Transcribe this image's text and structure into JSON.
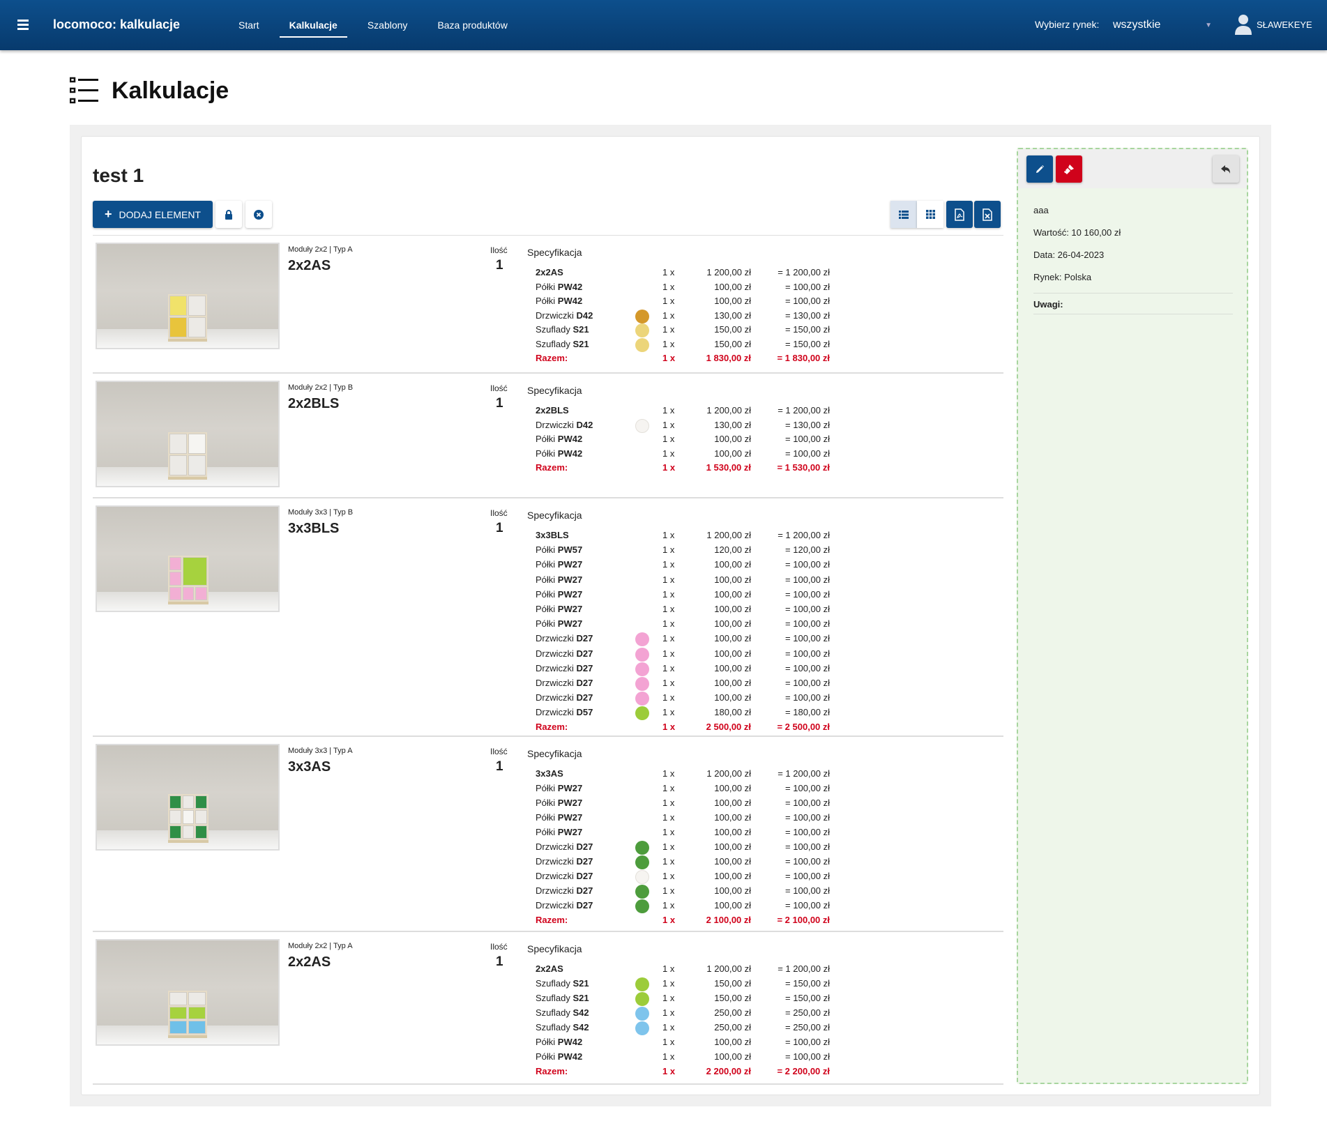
{
  "app": {
    "title": "locomoco: kalkulacje"
  },
  "nav": [
    {
      "label": "Start",
      "active": false
    },
    {
      "label": "Kalkulacje",
      "active": true
    },
    {
      "label": "Szablony",
      "active": false
    },
    {
      "label": "Baza produktów",
      "active": false
    }
  ],
  "market": {
    "label": "Wybierz rynek:",
    "value": "wszystkie"
  },
  "user": {
    "name": "SŁAWEKEYE"
  },
  "page": {
    "title": "Kalkulacje"
  },
  "calc": {
    "title": "test 1",
    "add_label": "DODAJ ELEMENT"
  },
  "rows": [
    {
      "type": "Moduły 2x2 | Typ A",
      "name": "2x2AS",
      "qty_label": "Ilość",
      "qty": "1",
      "spec_title": "Specyfikacja",
      "lines": [
        {
          "name": "",
          "code": "2x2AS",
          "color": null,
          "qty": "1 x",
          "price": "1 200,00 zł",
          "total": "= 1 200,00 zł"
        },
        {
          "name": "Półki ",
          "code": "PW42",
          "color": null,
          "qty": "1 x",
          "price": "100,00 zł",
          "total": "= 100,00 zł"
        },
        {
          "name": "Półki ",
          "code": "PW42",
          "color": null,
          "qty": "1 x",
          "price": "100,00 zł",
          "total": "= 100,00 zł"
        },
        {
          "name": "Drzwiczki ",
          "code": "D42",
          "color": "#d4982a",
          "qty": "1 x",
          "price": "130,00 zł",
          "total": "= 130,00 zł"
        },
        {
          "name": "Szuflady ",
          "code": "S21",
          "color": "#ecd57a",
          "qty": "1 x",
          "price": "150,00 zł",
          "total": "= 150,00 zł"
        },
        {
          "name": "Szuflady ",
          "code": "S21",
          "color": "#ecd57a",
          "qty": "1 x",
          "price": "150,00 zł",
          "total": "= 150,00 zł"
        }
      ],
      "total": {
        "label": "Razem:",
        "qty": "1 x",
        "price": "1 830,00 zł",
        "total": "= 1 830,00 zł"
      }
    },
    {
      "type": "Moduły 2x2 | Typ B",
      "name": "2x2BLS",
      "qty_label": "Ilość",
      "qty": "1",
      "spec_title": "Specyfikacja",
      "lines": [
        {
          "name": "",
          "code": "2x2BLS",
          "color": null,
          "qty": "1 x",
          "price": "1 200,00 zł",
          "total": "= 1 200,00 zł"
        },
        {
          "name": "Drzwiczki ",
          "code": "D42",
          "color": "#f6f4f1",
          "qty": "1 x",
          "price": "130,00 zł",
          "total": "= 130,00 zł"
        },
        {
          "name": "Półki ",
          "code": "PW42",
          "color": null,
          "qty": "1 x",
          "price": "100,00 zł",
          "total": "= 100,00 zł"
        },
        {
          "name": "Półki ",
          "code": "PW42",
          "color": null,
          "qty": "1 x",
          "price": "100,00 zł",
          "total": "= 100,00 zł"
        }
      ],
      "total": {
        "label": "Razem:",
        "qty": "1 x",
        "price": "1 530,00 zł",
        "total": "= 1 530,00 zł"
      }
    },
    {
      "type": "Moduły 3x3 | Typ B",
      "name": "3x3BLS",
      "qty_label": "Ilość",
      "qty": "1",
      "spec_title": "Specyfikacja",
      "lines": [
        {
          "name": "",
          "code": "3x3BLS",
          "color": null,
          "qty": "1 x",
          "price": "1 200,00 zł",
          "total": "= 1 200,00 zł"
        },
        {
          "name": "Półki ",
          "code": "PW57",
          "color": null,
          "qty": "1 x",
          "price": "120,00 zł",
          "total": "= 120,00 zł"
        },
        {
          "name": "Półki ",
          "code": "PW27",
          "color": null,
          "qty": "1 x",
          "price": "100,00 zł",
          "total": "= 100,00 zł"
        },
        {
          "name": "Półki ",
          "code": "PW27",
          "color": null,
          "qty": "1 x",
          "price": "100,00 zł",
          "total": "= 100,00 zł"
        },
        {
          "name": "Półki ",
          "code": "PW27",
          "color": null,
          "qty": "1 x",
          "price": "100,00 zł",
          "total": "= 100,00 zł"
        },
        {
          "name": "Półki ",
          "code": "PW27",
          "color": null,
          "qty": "1 x",
          "price": "100,00 zł",
          "total": "= 100,00 zł"
        },
        {
          "name": "Półki ",
          "code": "PW27",
          "color": null,
          "qty": "1 x",
          "price": "100,00 zł",
          "total": "= 100,00 zł"
        },
        {
          "name": "Drzwiczki ",
          "code": "D27",
          "color": "#f3a3d3",
          "qty": "1 x",
          "price": "100,00 zł",
          "total": "= 100,00 zł"
        },
        {
          "name": "Drzwiczki ",
          "code": "D27",
          "color": "#f3a3d3",
          "qty": "1 x",
          "price": "100,00 zł",
          "total": "= 100,00 zł"
        },
        {
          "name": "Drzwiczki ",
          "code": "D27",
          "color": "#f3a3d3",
          "qty": "1 x",
          "price": "100,00 zł",
          "total": "= 100,00 zł"
        },
        {
          "name": "Drzwiczki ",
          "code": "D27",
          "color": "#f3a3d3",
          "qty": "1 x",
          "price": "100,00 zł",
          "total": "= 100,00 zł"
        },
        {
          "name": "Drzwiczki ",
          "code": "D27",
          "color": "#f3a3d3",
          "qty": "1 x",
          "price": "100,00 zł",
          "total": "= 100,00 zł"
        },
        {
          "name": "Drzwiczki ",
          "code": "D57",
          "color": "#9ccc3a",
          "qty": "1 x",
          "price": "180,00 zł",
          "total": "= 180,00 zł"
        }
      ],
      "total": {
        "label": "Razem:",
        "qty": "1 x",
        "price": "2 500,00 zł",
        "total": "= 2 500,00 zł"
      }
    },
    {
      "type": "Moduły 3x3 | Typ A",
      "name": "3x3AS",
      "qty_label": "Ilość",
      "qty": "1",
      "spec_title": "Specyfikacja",
      "lines": [
        {
          "name": "",
          "code": "3x3AS",
          "color": null,
          "qty": "1 x",
          "price": "1 200,00 zł",
          "total": "= 1 200,00 zł"
        },
        {
          "name": "Półki ",
          "code": "PW27",
          "color": null,
          "qty": "1 x",
          "price": "100,00 zł",
          "total": "= 100,00 zł"
        },
        {
          "name": "Półki ",
          "code": "PW27",
          "color": null,
          "qty": "1 x",
          "price": "100,00 zł",
          "total": "= 100,00 zł"
        },
        {
          "name": "Półki ",
          "code": "PW27",
          "color": null,
          "qty": "1 x",
          "price": "100,00 zł",
          "total": "= 100,00 zł"
        },
        {
          "name": "Półki ",
          "code": "PW27",
          "color": null,
          "qty": "1 x",
          "price": "100,00 zł",
          "total": "= 100,00 zł"
        },
        {
          "name": "Drzwiczki ",
          "code": "D27",
          "color": "#4d9c3c",
          "qty": "1 x",
          "price": "100,00 zł",
          "total": "= 100,00 zł"
        },
        {
          "name": "Drzwiczki ",
          "code": "D27",
          "color": "#4d9c3c",
          "qty": "1 x",
          "price": "100,00 zł",
          "total": "= 100,00 zł"
        },
        {
          "name": "Drzwiczki ",
          "code": "D27",
          "color": "#f6f4f1",
          "qty": "1 x",
          "price": "100,00 zł",
          "total": "= 100,00 zł"
        },
        {
          "name": "Drzwiczki ",
          "code": "D27",
          "color": "#4d9c3c",
          "qty": "1 x",
          "price": "100,00 zł",
          "total": "= 100,00 zł"
        },
        {
          "name": "Drzwiczki ",
          "code": "D27",
          "color": "#4d9c3c",
          "qty": "1 x",
          "price": "100,00 zł",
          "total": "= 100,00 zł"
        }
      ],
      "total": {
        "label": "Razem:",
        "qty": "1 x",
        "price": "2 100,00 zł",
        "total": "= 2 100,00 zł"
      }
    },
    {
      "type": "Moduły 2x2 | Typ A",
      "name": "2x2AS",
      "qty_label": "Ilość",
      "qty": "1",
      "spec_title": "Specyfikacja",
      "lines": [
        {
          "name": "",
          "code": "2x2AS",
          "color": null,
          "qty": "1 x",
          "price": "1 200,00 zł",
          "total": "= 1 200,00 zł"
        },
        {
          "name": "Szuflady ",
          "code": "S21",
          "color": "#9ccc3a",
          "qty": "1 x",
          "price": "150,00 zł",
          "total": "= 150,00 zł"
        },
        {
          "name": "Szuflady ",
          "code": "S21",
          "color": "#9ccc3a",
          "qty": "1 x",
          "price": "150,00 zł",
          "total": "= 150,00 zł"
        },
        {
          "name": "Szuflady ",
          "code": "S42",
          "color": "#7ec4ec",
          "qty": "1 x",
          "price": "250,00 zł",
          "total": "= 250,00 zł"
        },
        {
          "name": "Szuflady ",
          "code": "S42",
          "color": "#7ec4ec",
          "qty": "1 x",
          "price": "250,00 zł",
          "total": "= 250,00 zł"
        },
        {
          "name": "Półki ",
          "code": "PW42",
          "color": null,
          "qty": "1 x",
          "price": "100,00 zł",
          "total": "= 100,00 zł"
        },
        {
          "name": "Półki ",
          "code": "PW42",
          "color": null,
          "qty": "1 x",
          "price": "100,00 zł",
          "total": "= 100,00 zł"
        }
      ],
      "total": {
        "label": "Razem:",
        "qty": "1 x",
        "price": "2 200,00 zł",
        "total": "= 2 200,00 zł"
      }
    }
  ],
  "side": {
    "description": "aaa",
    "value": "Wartość: 10 160,00 zł",
    "date": "Data: 26-04-2023",
    "market": "Rynek: Polska",
    "notes_label": "Uwagi:"
  },
  "colors": {
    "primary": "#0d4f8c",
    "danger": "#d0021b",
    "side_bg": "#eef6ea",
    "side_border": "#a8d59f"
  },
  "icons": [
    "menu-icon",
    "user-icon",
    "list-heading-icon",
    "plus-icon",
    "lock-icon",
    "close-circle-icon",
    "list-view-icon",
    "grid-view-icon",
    "pdf-icon",
    "excel-icon",
    "pencil-icon",
    "trash-icon",
    "brush-icon",
    "back-arrow-icon"
  ]
}
